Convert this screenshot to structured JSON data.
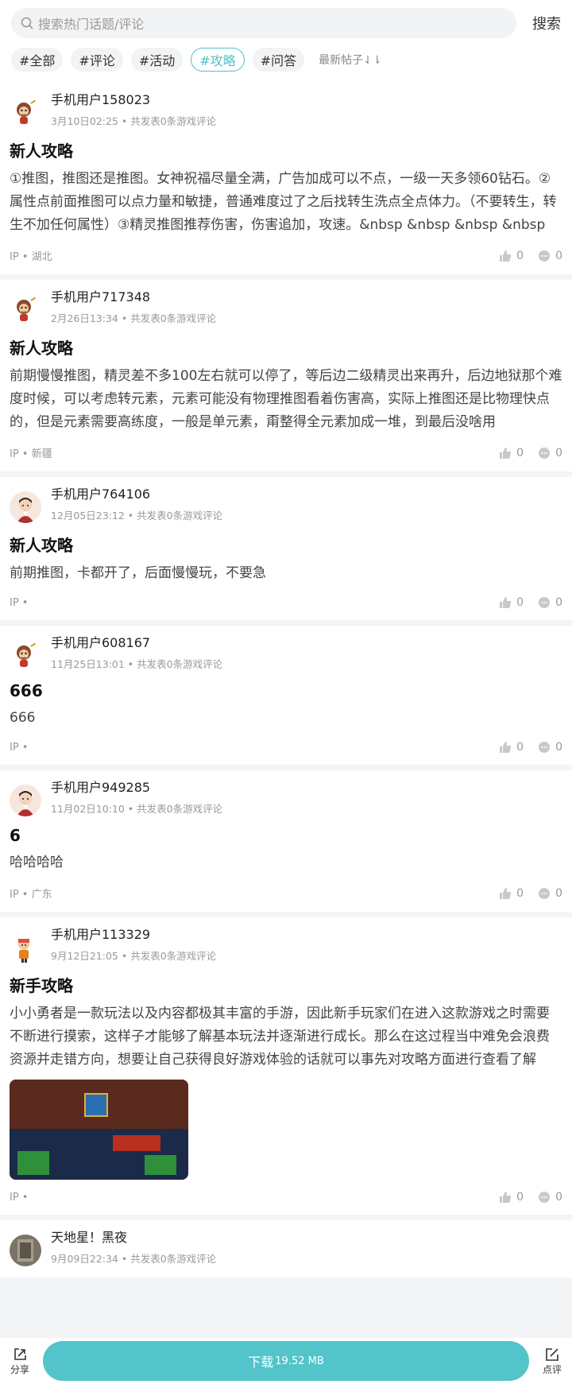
{
  "search": {
    "placeholder": "搜索热门话题/评论",
    "button_label": "搜索"
  },
  "tags": [
    "#全部",
    "#评论",
    "#活动",
    "#攻略",
    "#问答"
  ],
  "active_tag_index": 3,
  "sort_label": "最新帖子⇃⇂",
  "posts": [
    {
      "user": "手机用户158023",
      "meta": "3月10日02:25 • 共发表0条游戏评论",
      "title": "新人攻略",
      "body": "①推图，推图还是推图。女神祝福尽量全满，广告加成可以不点，一级一天多领60钻石。②属性点前面推图可以点力量和敏捷，普通难度过了之后找转生洗点全点体力。（不要转生，转生不加任何属性）③精灵推图推荐伤害，伤害追加，攻速。&nbsp &nbsp &nbsp &nbsp",
      "ip": "IP • 湖北",
      "likes": "0",
      "comments": "0",
      "avatar": "monkey"
    },
    {
      "user": "手机用户717348",
      "meta": "2月26日13:34 • 共发表0条游戏评论",
      "title": "新人攻略",
      "body": "前期慢慢推图，精灵差不多100左右就可以停了，等后边二级精灵出来再升，后边地狱那个难度时候，可以考虑转元素，元素可能没有物理推图看着伤害高，实际上推图还是比物理快点的，但是元素需要高练度，一般是单元素，甭整得全元素加成一堆，到最后没啥用",
      "ip": "IP • 新疆",
      "likes": "0",
      "comments": "0",
      "avatar": "monkey"
    },
    {
      "user": "手机用户764106",
      "meta": "12月05日23:12 • 共发表0条游戏评论",
      "title": "新人攻略",
      "body": "前期推图，卡都开了，后面慢慢玩，不要急",
      "ip": "IP •",
      "likes": "0",
      "comments": "0",
      "avatar": "boy"
    },
    {
      "user": "手机用户608167",
      "meta": "11月25日13:01 • 共发表0条游戏评论",
      "title": "666",
      "body": "666",
      "ip": "IP •",
      "likes": "0",
      "comments": "0",
      "avatar": "monkey"
    },
    {
      "user": "手机用户949285",
      "meta": "11月02日10:10 • 共发表0条游戏评论",
      "title": "6",
      "body": "哈哈哈哈",
      "ip": "IP • 广东",
      "likes": "0",
      "comments": "0",
      "avatar": "boy"
    },
    {
      "user": "手机用户113329",
      "meta": "9月12日21:05 • 共发表0条游戏评论",
      "title": "新手攻略",
      "body": "小小勇者是一款玩法以及内容都极其丰富的手游，因此新手玩家们在进入这款游戏之时需要不断进行摸索，这样子才能够了解基本玩法并逐渐进行成长。那么在这过程当中难免会浪费资源并走错方向，想要让自己获得良好游戏体验的话就可以事先对攻略方面进行查看了解",
      "ip": "IP •",
      "likes": "0",
      "comments": "0",
      "avatar": "ninja",
      "has_image": true
    },
    {
      "user": "天地星！黑夜",
      "meta": "9月09日22:34 • 共发表0条游戏评论",
      "title": "",
      "body": "",
      "ip": "",
      "likes": "",
      "comments": "",
      "avatar": "photo"
    }
  ],
  "bottom": {
    "share_label": "分享",
    "download_label": "下载",
    "download_size": "19.52 MB",
    "review_label": "点评"
  },
  "colors": {
    "accent": "#52c4ca",
    "active_tag": "#4fc3c9"
  }
}
